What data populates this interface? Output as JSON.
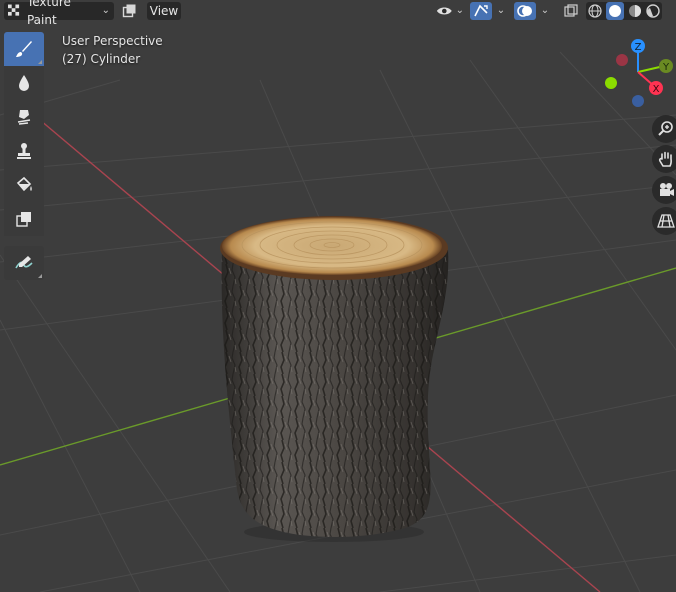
{
  "header": {
    "mode_label": "Texture Paint",
    "view_menu": "View"
  },
  "overlay": {
    "view_name": "User Perspective",
    "object_name": "(27) Cylinder"
  },
  "gizmo": {
    "z_label": "Z",
    "y_label": "Y",
    "x_label": "X"
  },
  "toolbar": {
    "tools": [
      "draw-brush",
      "soften-brush",
      "smear-brush",
      "clone-brush",
      "fill-brush",
      "mask-brush",
      "annotate-tool"
    ],
    "active_tool": "draw-brush"
  },
  "colors": {
    "viewport_bg": "#3d3d3d",
    "grid": "#4a4a4a",
    "x_axis": "#a8444f",
    "y_axis": "#6a9a2a",
    "active_tool": "#4772b3",
    "gizmo_x": "#ff3352",
    "gizmo_y": "#8bdc00",
    "gizmo_z": "#2890ff"
  }
}
